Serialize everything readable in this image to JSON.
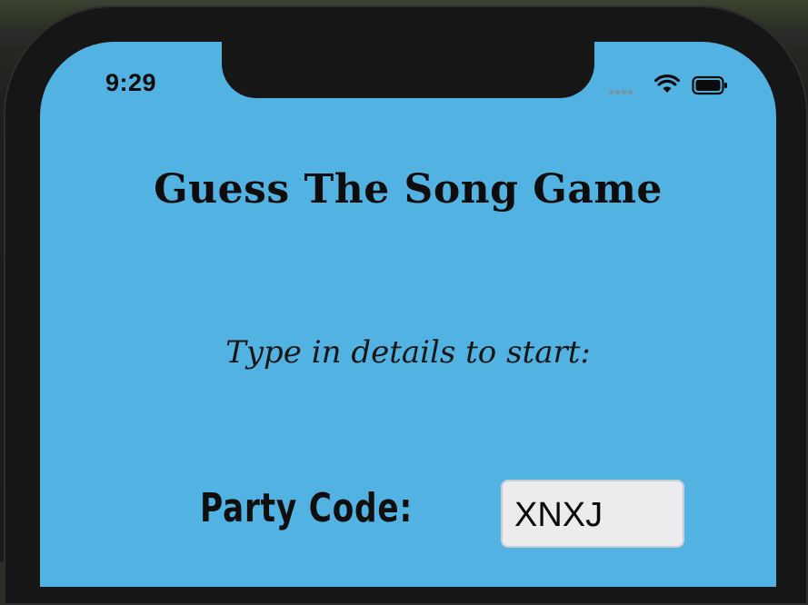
{
  "status_bar": {
    "time": "9:29",
    "signal_icon": "signal-dots-icon",
    "wifi_icon": "wifi-icon",
    "battery_icon": "battery-icon"
  },
  "screen": {
    "background_color": "#52b3e2",
    "title": "Guess The Song Game",
    "subtitle": "Type in details to start:",
    "party_code_label": "Party Code:",
    "party_code_value": "XNXJ"
  }
}
